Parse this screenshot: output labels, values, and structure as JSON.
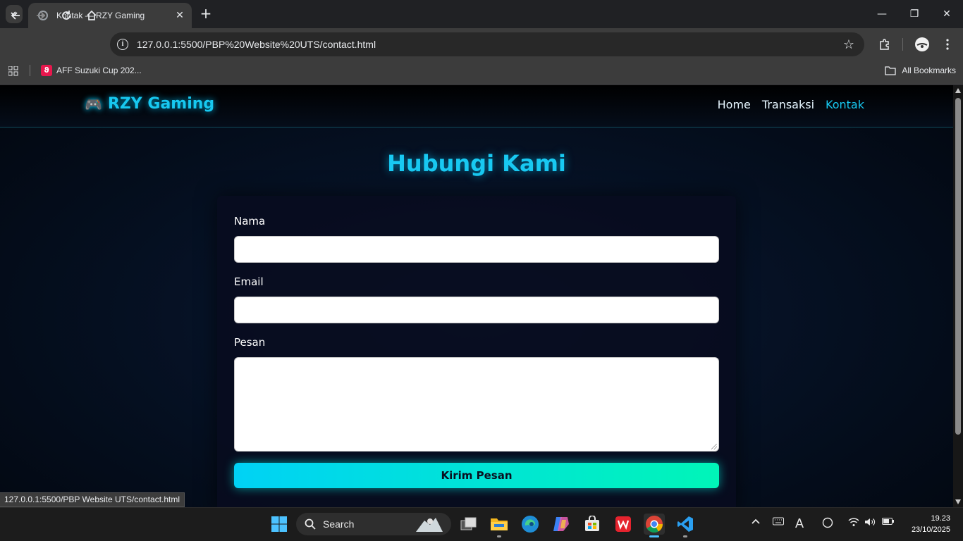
{
  "browser": {
    "tab": {
      "title": "Kontak — RZY Gaming"
    },
    "new_tab_symbol": "+",
    "window_controls": {
      "minimize": "—",
      "maximize": "❐",
      "close": "✕"
    },
    "address_bar": {
      "url": "127.0.0.1:5500/PBP%20Website%20UTS/contact.html"
    },
    "bookmarks": {
      "items": [
        {
          "label": "AFF Suzuki Cup 202...",
          "favicon_letter": "ϑ"
        }
      ],
      "all_bookmarks_label": "All Bookmarks"
    },
    "status_url": "127.0.0.1:5500/PBP Website UTS/contact.html"
  },
  "site": {
    "logo": {
      "icon": "🎮",
      "text": "RZY Gaming"
    },
    "nav": [
      {
        "label": "Home",
        "active": false
      },
      {
        "label": "Transaksi",
        "active": false
      },
      {
        "label": "Kontak",
        "active": true
      }
    ],
    "page_title": "Hubungi Kami",
    "form": {
      "name_label": "Nama",
      "name_value": "",
      "email_label": "Email",
      "email_value": "",
      "message_label": "Pesan",
      "message_value": "",
      "submit_label": "Kirim Pesan"
    }
  },
  "taskbar": {
    "search_label": "Search",
    "clock": {
      "time": "19.23",
      "date": "23/10/2025"
    },
    "tray_ime": "A"
  },
  "colors": {
    "accent_cyan": "#17c8f0",
    "button_gradient_start": "#00d2f5",
    "button_gradient_end": "#00f5b8"
  }
}
